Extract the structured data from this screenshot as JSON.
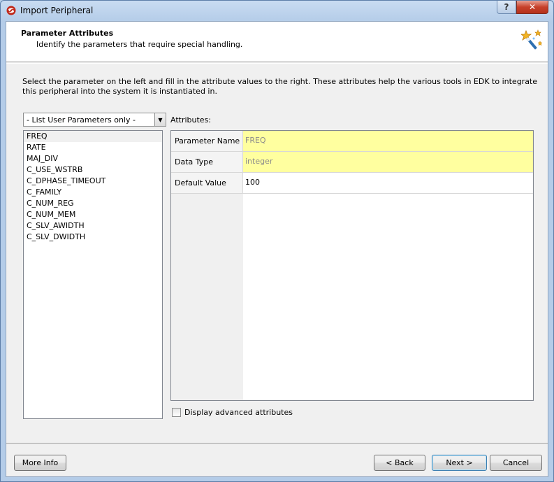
{
  "window": {
    "title": "Import Peripheral",
    "help_label": "?",
    "close_label": "✕"
  },
  "header": {
    "title": "Parameter Attributes",
    "subtitle": "Identify the parameters that require special handling."
  },
  "instructions": "Select the parameter on the left and fill in the attribute values to the right. These attributes help the various tools in EDK to integrate this peripheral into the system it is instantiated in.",
  "filter": {
    "selected": "- List User Parameters only -"
  },
  "parameters": [
    "FREQ",
    "RATE",
    "MAJ_DIV",
    "C_USE_WSTRB",
    "C_DPHASE_TIMEOUT",
    "C_FAMILY",
    "C_NUM_REG",
    "C_NUM_MEM",
    "C_SLV_AWIDTH",
    "C_SLV_DWIDTH"
  ],
  "attributes_label": "Attributes:",
  "attributes": [
    {
      "key": "Parameter Name",
      "value": "FREQ",
      "readonly": true
    },
    {
      "key": "Data Type",
      "value": "integer",
      "readonly": true
    },
    {
      "key": "Default Value",
      "value": "100",
      "readonly": false
    }
  ],
  "advanced": {
    "label": "Display advanced attributes",
    "checked": false
  },
  "buttons": {
    "more_info": "More Info",
    "back": "< Back",
    "next": "Next >",
    "cancel": "Cancel"
  },
  "colors": {
    "readonly_bg": "#ffff9f",
    "close_red": "#c7412b",
    "selection": "#f0f0f0"
  },
  "icons": {
    "app": "app-icon",
    "wizard": "wand-icon",
    "dropdown": "chevron-down-icon"
  }
}
